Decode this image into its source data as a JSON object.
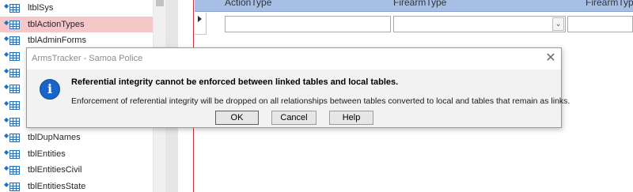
{
  "nav": {
    "items": [
      {
        "label": "ltblSys",
        "selected": false
      },
      {
        "label": "tblActionTypes",
        "selected": true
      },
      {
        "label": "tblAdminForms",
        "selected": false
      },
      {
        "label": "",
        "selected": false
      },
      {
        "label": "",
        "selected": false
      },
      {
        "label": "",
        "selected": false
      },
      {
        "label": "",
        "selected": false
      },
      {
        "label": "",
        "selected": false
      },
      {
        "label": "tblDupNames",
        "selected": false
      },
      {
        "label": "tblEntities",
        "selected": false
      },
      {
        "label": "tblEntitiesCivil",
        "selected": false
      },
      {
        "label": "tblEntitiesState",
        "selected": false
      }
    ],
    "selected_color": "#f5c7c8",
    "icon": "linked-table-icon"
  },
  "sheet": {
    "columns": [
      "ActionType",
      "FirearmType",
      "FirearmType"
    ],
    "header_color": "#a7bfe5",
    "record_selector_icon": "current-record-triangle-icon",
    "dropdown_icon": "chevron-down-icon",
    "dropdown_glyph": "⌄"
  },
  "dialog": {
    "title": "ArmsTracker - Samoa Police",
    "close_glyph": "✕",
    "icon": "info-icon",
    "icon_glyph": "i",
    "icon_color": "#1a64c8",
    "message": "Referential integrity cannot be enforced between linked tables and local tables.",
    "detail": "Enforcement of referential integrity will be dropped on all relationships between tables converted to local and tables that remain as links.",
    "buttons": {
      "ok": "OK",
      "cancel": "Cancel",
      "help": "Help"
    }
  }
}
